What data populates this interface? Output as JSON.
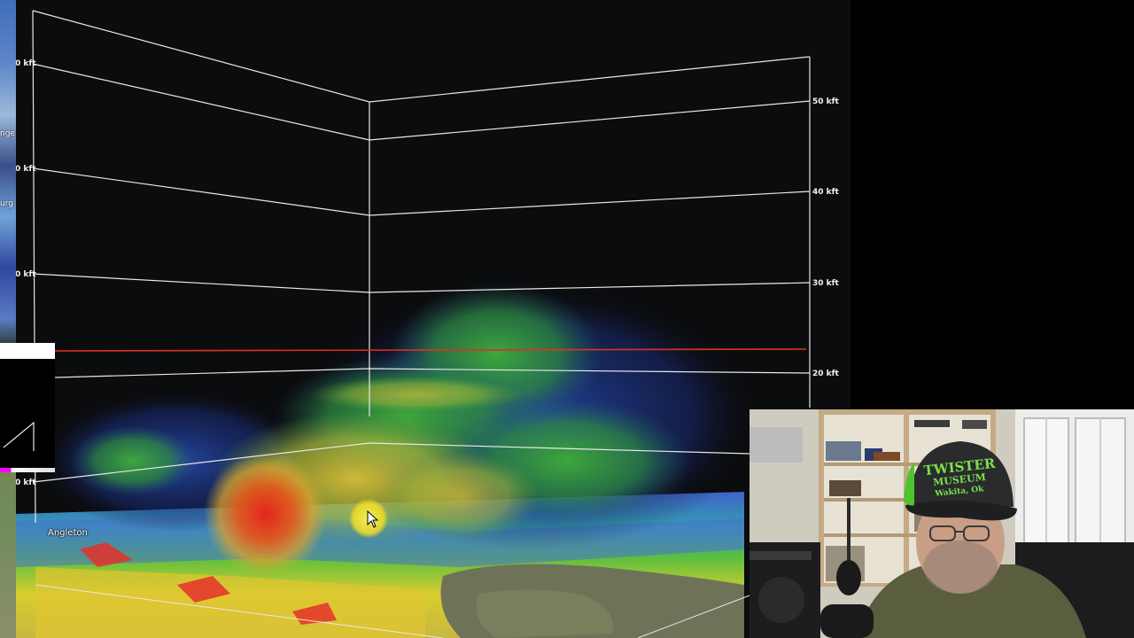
{
  "viewport": {
    "altitude_labels_right": [
      "50 kft",
      "40 kft",
      "30 kft",
      "20 kft"
    ],
    "altitude_labels_left": [
      "0 kft",
      "0 kft",
      "0 kft",
      "0 kft"
    ],
    "place_label": "Angleton",
    "map_strip_labels": [
      "nge",
      "urg"
    ]
  },
  "colors": {
    "background": "#0b0c0e",
    "grid_line": "#e8e8e8",
    "freezing_level_line": "#e03020",
    "reflectivity_high": "#e8361a",
    "reflectivity_mid": "#e0c030",
    "reflectivity_low": "#3aa83a",
    "reflectivity_lowest": "#2a4fb8",
    "cursor_highlight": "#f2e64a"
  },
  "webcam": {
    "hat_text_line1": "TWISTER",
    "hat_text_line2": "MUSEUM",
    "hat_text_line3": "Wakita, Ok"
  }
}
